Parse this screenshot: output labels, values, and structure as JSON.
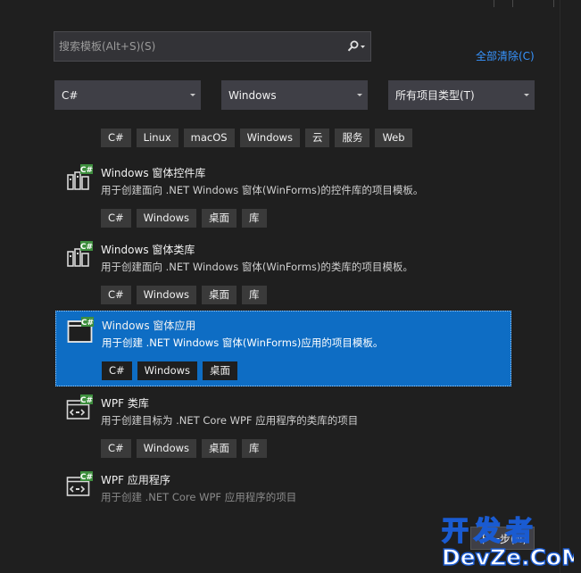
{
  "search": {
    "placeholder": "搜索模板(Alt+S)(S)"
  },
  "clear_all": "全部清除(C)",
  "filters": {
    "language": "C#",
    "platform": "Windows",
    "project_type": "所有项目类型(T)"
  },
  "top_tags": [
    "C#",
    "Linux",
    "macOS",
    "Windows",
    "云",
    "服务",
    "Web"
  ],
  "templates": [
    {
      "title": "Windows 窗体控件库",
      "description": "用于创建面向 .NET Windows 窗体(WinForms)的控件库的项目模板。",
      "tags": [
        "C#",
        "Windows",
        "桌面",
        "库"
      ],
      "icon": "control-library-icon",
      "selected": false
    },
    {
      "title": "Windows 窗体类库",
      "description": "用于创建面向 .NET Windows 窗体(WinForms)的类库的项目模板。",
      "tags": [
        "C#",
        "Windows",
        "桌面",
        "库"
      ],
      "icon": "class-library-icon",
      "selected": false
    },
    {
      "title": "Windows 窗体应用",
      "description": "用于创建 .NET Windows 窗体(WinForms)应用的项目模板。",
      "tags": [
        "C#",
        "Windows",
        "桌面"
      ],
      "icon": "window-app-icon",
      "selected": true
    },
    {
      "title": "WPF 类库",
      "description": "用于创建目标为 .NET Core WPF 应用程序的类库的项目",
      "tags": [
        "C#",
        "Windows",
        "桌面",
        "库"
      ],
      "icon": "wpf-library-icon",
      "selected": false
    },
    {
      "title": "WPF 应用程序",
      "description": "用于创建 .NET Core WPF 应用程序的项目",
      "tags": [],
      "icon": "wpf-app-icon",
      "selected": false
    }
  ],
  "next_button": "下一步(N)",
  "watermark": "开发者 DevZe.CoM",
  "colors": {
    "accent": "#0e6dc4",
    "link": "#3794ff",
    "background": "#1f1f1f"
  }
}
